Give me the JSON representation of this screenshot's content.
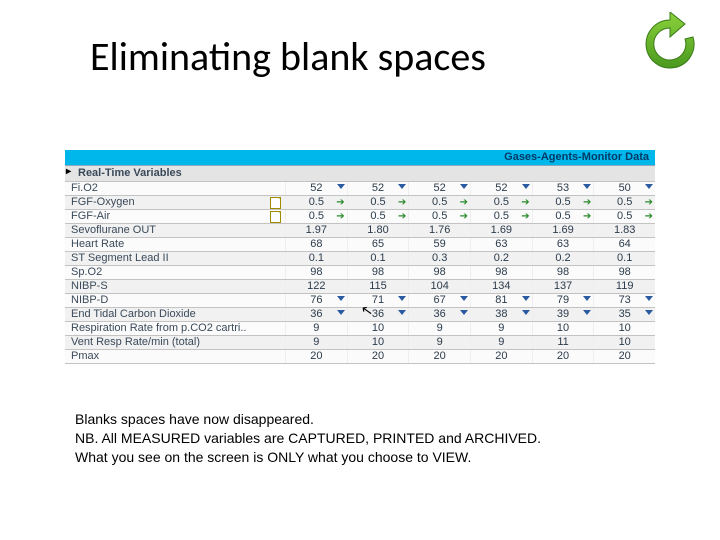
{
  "title": "Eliminating blank spaces",
  "sectionBar": "Gases-Agents-Monitor Data",
  "subheader": {
    "marker": "▸",
    "label": "Real-Time Variables"
  },
  "columns": 6,
  "rows": [
    {
      "label": "Fi.O2",
      "values": [
        "52",
        "52",
        "52",
        "52",
        "53",
        "50"
      ],
      "marks": [
        "tri",
        "tri",
        "tri",
        "tri",
        "tri",
        "tri"
      ]
    },
    {
      "label": "FGF-Oxygen",
      "doc": true,
      "values": [
        "0.5",
        "0.5",
        "0.5",
        "0.5",
        "0.5",
        "0.5"
      ],
      "marks": [
        "arr",
        "arr",
        "arr",
        "arr",
        "arr",
        "arr"
      ]
    },
    {
      "label": "FGF-Air",
      "doc": true,
      "values": [
        "0.5",
        "0.5",
        "0.5",
        "0.5",
        "0.5",
        "0.5"
      ],
      "marks": [
        "arr",
        "arr",
        "arr",
        "arr",
        "arr",
        "arr"
      ]
    },
    {
      "label": "Sevoflurane OUT",
      "values": [
        "1.97",
        "1.80",
        "1.76",
        "1.69",
        "1.69",
        "1.83"
      ],
      "marks": [
        "",
        "",
        "",
        "",
        "",
        ""
      ]
    },
    {
      "label": "Heart Rate",
      "values": [
        "68",
        "65",
        "59",
        "63",
        "63",
        "64"
      ],
      "marks": [
        "",
        "",
        "",
        "",
        "",
        ""
      ]
    },
    {
      "label": "ST Segment Lead II",
      "values": [
        "0.1",
        "0.1",
        "0.3",
        "0.2",
        "0.2",
        "0.1"
      ],
      "marks": [
        "",
        "",
        "",
        "",
        "",
        ""
      ]
    },
    {
      "label": "Sp.O2",
      "values": [
        "98",
        "98",
        "98",
        "98",
        "98",
        "98"
      ],
      "marks": [
        "",
        "",
        "",
        "",
        "",
        ""
      ]
    },
    {
      "label": "NIBP-S",
      "values": [
        "122",
        "115",
        "104",
        "134",
        "137",
        "119"
      ],
      "marks": [
        "",
        "",
        "",
        "",
        "",
        ""
      ]
    },
    {
      "label": "NIBP-D",
      "values": [
        "76",
        "71",
        "67",
        "81",
        "79",
        "73"
      ],
      "marks": [
        "tri",
        "tri",
        "tri",
        "tri",
        "tri",
        "tri"
      ]
    },
    {
      "label": "End Tidal Carbon Dioxide",
      "values": [
        "36",
        "36",
        "36",
        "38",
        "39",
        "35"
      ],
      "marks": [
        "tri",
        "tri",
        "tri",
        "tri",
        "tri",
        "tri"
      ]
    },
    {
      "label": "Respiration Rate from p.CO2 cartri..",
      "values": [
        "9",
        "10",
        "9",
        "9",
        "10",
        "10"
      ],
      "marks": [
        "",
        "",
        "",
        "",
        "",
        ""
      ]
    },
    {
      "label": "Vent Resp Rate/min (total)",
      "values": [
        "9",
        "10",
        "9",
        "9",
        "11",
        "10"
      ],
      "marks": [
        "",
        "",
        "",
        "",
        "",
        ""
      ]
    },
    {
      "label": "Pmax",
      "values": [
        "20",
        "20",
        "20",
        "20",
        "20",
        "20"
      ],
      "marks": [
        "",
        "",
        "",
        "",
        "",
        ""
      ]
    }
  ],
  "caption": {
    "l1": "Blanks spaces have now disappeared.",
    "l2": "NB. All MEASURED variables are CAPTURED, PRINTED and ARCHIVED.",
    "l3": "What you see on the screen is ONLY what you choose to VIEW."
  },
  "icons": {
    "refresh": "refresh-icon"
  }
}
